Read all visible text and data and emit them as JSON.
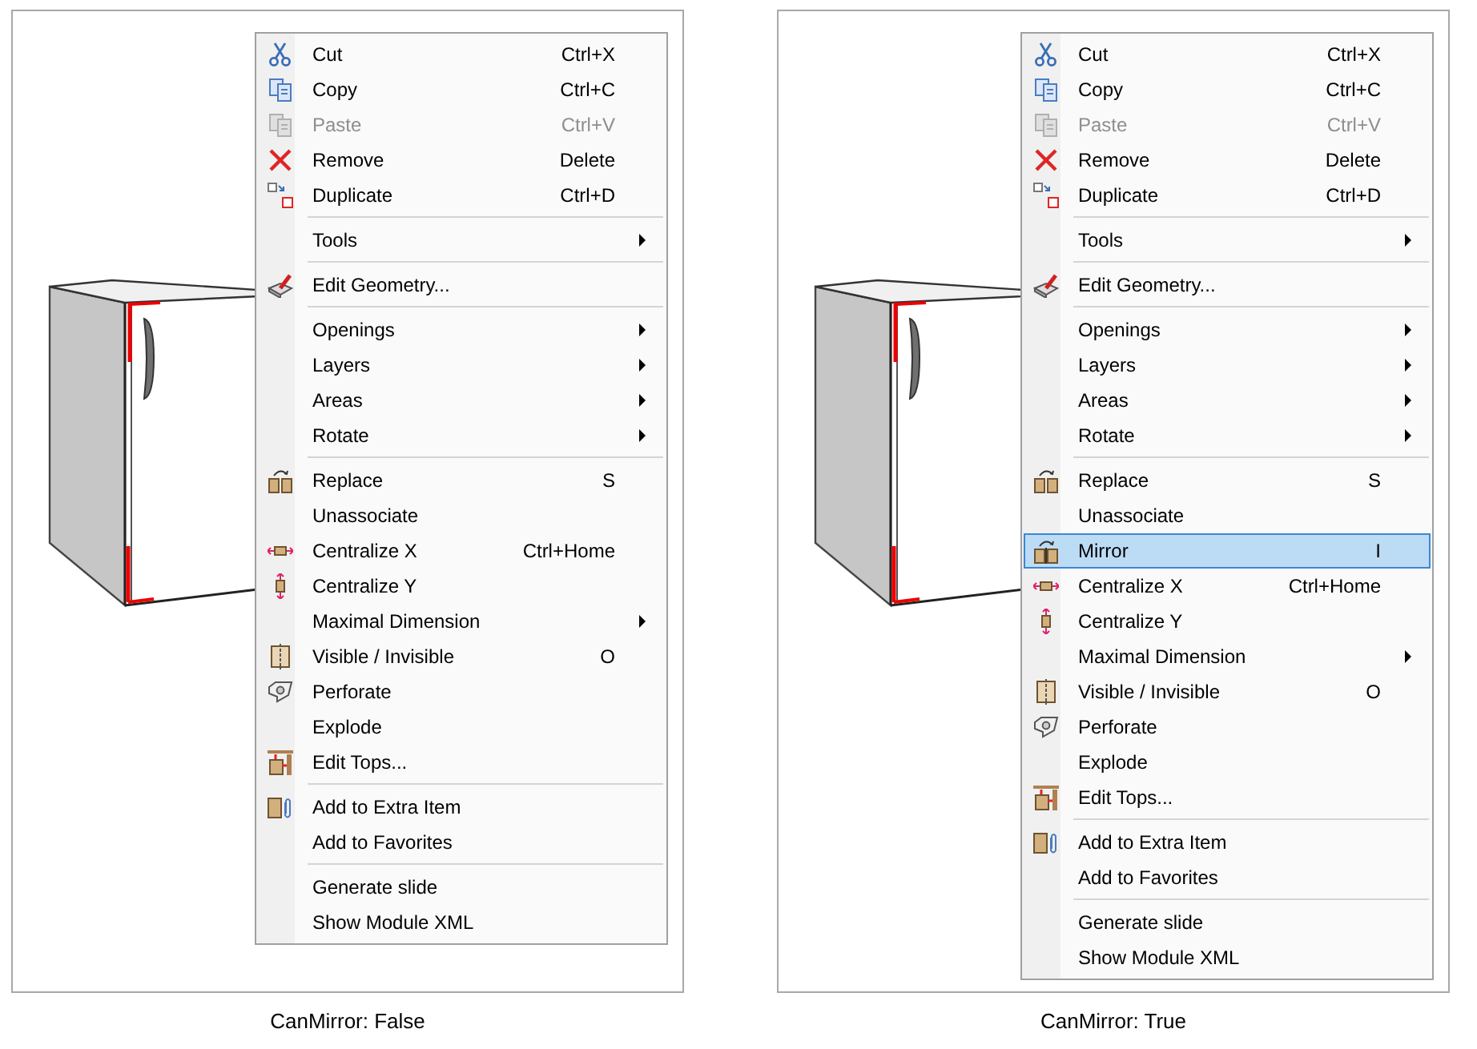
{
  "panels": [
    {
      "caption": "CanMirror: False",
      "menu": [
        {
          "items": [
            {
              "label": "Cut",
              "shortcut": "Ctrl+X",
              "kind": "cut",
              "submenu": false,
              "disabled": false,
              "selected": false
            },
            {
              "label": "Copy",
              "shortcut": "Ctrl+C",
              "kind": "copy",
              "submenu": false,
              "disabled": false,
              "selected": false
            },
            {
              "label": "Paste",
              "shortcut": "Ctrl+V",
              "kind": "paste",
              "submenu": false,
              "disabled": true,
              "selected": false
            },
            {
              "label": "Remove",
              "shortcut": "Delete",
              "kind": "remove",
              "submenu": false,
              "disabled": false,
              "selected": false
            },
            {
              "label": "Duplicate",
              "shortcut": "Ctrl+D",
              "kind": "duplicate",
              "submenu": false,
              "disabled": false,
              "selected": false
            }
          ]
        },
        {
          "items": [
            {
              "label": "Tools",
              "submenu": true,
              "disabled": false,
              "selected": false
            }
          ]
        },
        {
          "items": [
            {
              "label": "Edit Geometry...",
              "kind": "geometry",
              "submenu": false,
              "disabled": false,
              "selected": false
            }
          ]
        },
        {
          "items": [
            {
              "label": "Openings",
              "submenu": true,
              "disabled": false,
              "selected": false
            },
            {
              "label": "Layers",
              "submenu": true,
              "disabled": false,
              "selected": false
            },
            {
              "label": "Areas",
              "submenu": true,
              "disabled": false,
              "selected": false
            },
            {
              "label": "Rotate",
              "submenu": true,
              "disabled": false,
              "selected": false
            }
          ]
        },
        {
          "items": [
            {
              "label": "Replace",
              "shortcut": "S",
              "kind": "replace",
              "submenu": false,
              "disabled": false,
              "selected": false
            },
            {
              "label": "Unassociate",
              "submenu": false,
              "disabled": false,
              "selected": false
            },
            {
              "label": "Centralize X",
              "shortcut": "Ctrl+Home",
              "kind": "center-x",
              "submenu": false,
              "disabled": false,
              "selected": false
            },
            {
              "label": "Centralize Y",
              "kind": "center-y",
              "submenu": false,
              "disabled": false,
              "selected": false
            },
            {
              "label": "Maximal Dimension",
              "submenu": true,
              "disabled": false,
              "selected": false
            },
            {
              "label": "Visible / Invisible",
              "shortcut": "O",
              "kind": "visible",
              "submenu": false,
              "disabled": false,
              "selected": false
            },
            {
              "label": "Perforate",
              "kind": "perforate",
              "submenu": false,
              "disabled": false,
              "selected": false
            },
            {
              "label": "Explode",
              "submenu": false,
              "disabled": false,
              "selected": false
            },
            {
              "label": "Edit Tops...",
              "kind": "tops",
              "submenu": false,
              "disabled": false,
              "selected": false
            }
          ]
        },
        {
          "items": [
            {
              "label": "Add to Extra Item",
              "kind": "extra",
              "submenu": false,
              "disabled": false,
              "selected": false
            },
            {
              "label": "Add to Favorites",
              "submenu": false,
              "disabled": false,
              "selected": false
            }
          ]
        },
        {
          "items": [
            {
              "label": "Generate slide",
              "submenu": false,
              "disabled": false,
              "selected": false
            },
            {
              "label": "Show Module XML",
              "submenu": false,
              "disabled": false,
              "selected": false
            }
          ]
        }
      ]
    },
    {
      "caption": "CanMirror: True",
      "menu": [
        {
          "items": [
            {
              "label": "Cut",
              "shortcut": "Ctrl+X",
              "kind": "cut",
              "submenu": false,
              "disabled": false,
              "selected": false
            },
            {
              "label": "Copy",
              "shortcut": "Ctrl+C",
              "kind": "copy",
              "submenu": false,
              "disabled": false,
              "selected": false
            },
            {
              "label": "Paste",
              "shortcut": "Ctrl+V",
              "kind": "paste",
              "submenu": false,
              "disabled": true,
              "selected": false
            },
            {
              "label": "Remove",
              "shortcut": "Delete",
              "kind": "remove",
              "submenu": false,
              "disabled": false,
              "selected": false
            },
            {
              "label": "Duplicate",
              "shortcut": "Ctrl+D",
              "kind": "duplicate",
              "submenu": false,
              "disabled": false,
              "selected": false
            }
          ]
        },
        {
          "items": [
            {
              "label": "Tools",
              "submenu": true,
              "disabled": false,
              "selected": false
            }
          ]
        },
        {
          "items": [
            {
              "label": "Edit Geometry...",
              "kind": "geometry",
              "submenu": false,
              "disabled": false,
              "selected": false
            }
          ]
        },
        {
          "items": [
            {
              "label": "Openings",
              "submenu": true,
              "disabled": false,
              "selected": false
            },
            {
              "label": "Layers",
              "submenu": true,
              "disabled": false,
              "selected": false
            },
            {
              "label": "Areas",
              "submenu": true,
              "disabled": false,
              "selected": false
            },
            {
              "label": "Rotate",
              "submenu": true,
              "disabled": false,
              "selected": false
            }
          ]
        },
        {
          "items": [
            {
              "label": "Replace",
              "shortcut": "S",
              "kind": "replace",
              "submenu": false,
              "disabled": false,
              "selected": false
            },
            {
              "label": "Unassociate",
              "submenu": false,
              "disabled": false,
              "selected": false
            },
            {
              "label": "Mirror",
              "shortcut": "I",
              "kind": "mirror",
              "submenu": false,
              "disabled": false,
              "selected": true
            },
            {
              "label": "Centralize X",
              "shortcut": "Ctrl+Home",
              "kind": "center-x",
              "submenu": false,
              "disabled": false,
              "selected": false
            },
            {
              "label": "Centralize Y",
              "kind": "center-y",
              "submenu": false,
              "disabled": false,
              "selected": false
            },
            {
              "label": "Maximal Dimension",
              "submenu": true,
              "disabled": false,
              "selected": false
            },
            {
              "label": "Visible / Invisible",
              "shortcut": "O",
              "kind": "visible",
              "submenu": false,
              "disabled": false,
              "selected": false
            },
            {
              "label": "Perforate",
              "kind": "perforate",
              "submenu": false,
              "disabled": false,
              "selected": false
            },
            {
              "label": "Explode",
              "submenu": false,
              "disabled": false,
              "selected": false
            },
            {
              "label": "Edit Tops...",
              "kind": "tops",
              "submenu": false,
              "disabled": false,
              "selected": false
            }
          ]
        },
        {
          "items": [
            {
              "label": "Add to Extra Item",
              "kind": "extra",
              "submenu": false,
              "disabled": false,
              "selected": false
            },
            {
              "label": "Add to Favorites",
              "submenu": false,
              "disabled": false,
              "selected": false
            }
          ]
        },
        {
          "items": [
            {
              "label": "Generate slide",
              "submenu": false,
              "disabled": false,
              "selected": false
            },
            {
              "label": "Show Module XML",
              "submenu": false,
              "disabled": false,
              "selected": false
            }
          ]
        }
      ]
    }
  ]
}
